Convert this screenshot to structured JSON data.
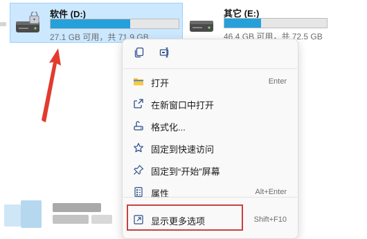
{
  "drives": [
    {
      "name": "软件 (D:)",
      "size_text": "27.1 GB 可用，共 71.9 GB",
      "used_fraction": 0.62,
      "selected": true
    },
    {
      "name": "其它 (E:)",
      "size_text": "46.4 GB 可用，共 72.5 GB",
      "used_fraction": 0.36,
      "selected": false
    }
  ],
  "quick_actions": [
    {
      "icon": "copy-icon"
    },
    {
      "icon": "rename-icon"
    }
  ],
  "menu_items": [
    {
      "label": "打开",
      "shortcut": "Enter",
      "icon": "folder-icon"
    },
    {
      "label": "在新窗口中打开",
      "shortcut": "",
      "icon": "open-new-window-icon"
    },
    {
      "label": "格式化...",
      "shortcut": "",
      "icon": "format-icon"
    },
    {
      "label": "固定到快速访问",
      "shortcut": "",
      "icon": "star-icon"
    },
    {
      "label": "固定到“开始”屏幕",
      "shortcut": "",
      "icon": "pin-icon"
    },
    {
      "label": "属性",
      "shortcut": "Alt+Enter",
      "icon": "properties-icon"
    },
    {
      "label": "显示更多选项",
      "shortcut": "Shift+F10",
      "icon": "show-more-options-icon"
    }
  ],
  "annotation": {
    "highlight_target": "显示更多选项",
    "highlight_color": "#c8413f",
    "arrow_color": "#e23b2e"
  },
  "colors": {
    "accent": "#26a0da",
    "selection": "#cce8ff",
    "selection_border": "#99d1ff"
  }
}
